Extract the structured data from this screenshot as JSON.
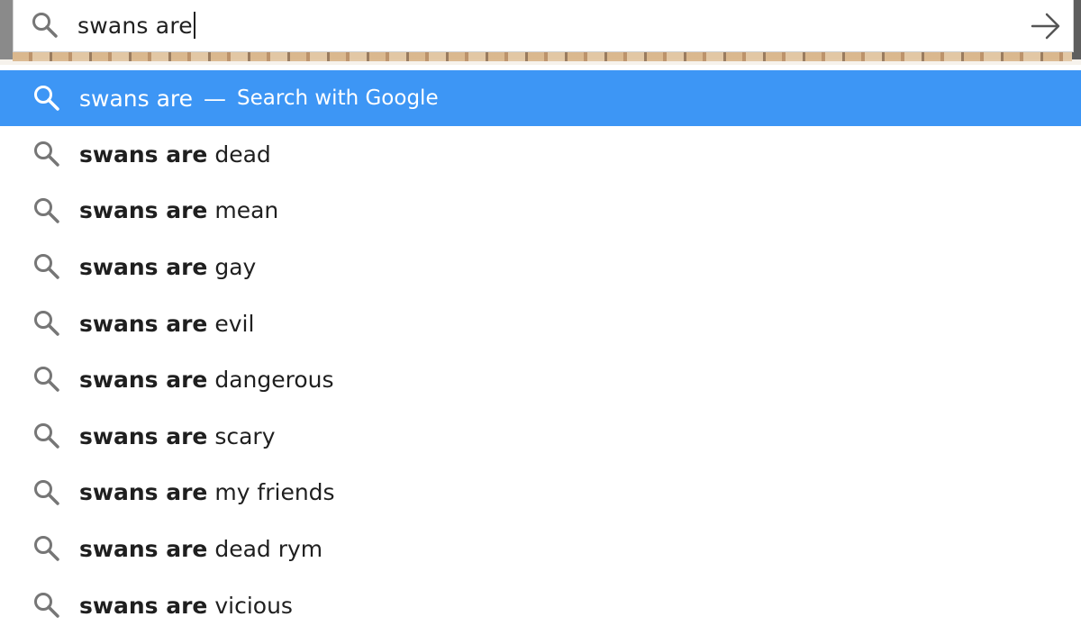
{
  "search": {
    "query": "swans are"
  },
  "dropdown": {
    "primary": {
      "query": "swans are",
      "separator": "—",
      "action": "Search with Google"
    },
    "suggestions": [
      {
        "prefix": "swans are",
        "rest": " dead"
      },
      {
        "prefix": "swans are",
        "rest": " mean"
      },
      {
        "prefix": "swans are",
        "rest": " gay"
      },
      {
        "prefix": "swans are",
        "rest": " evil"
      },
      {
        "prefix": "swans are",
        "rest": " dangerous"
      },
      {
        "prefix": "swans are",
        "rest": " scary"
      },
      {
        "prefix": "swans are",
        "rest": " my friends"
      },
      {
        "prefix": "swans are",
        "rest": " dead rym"
      },
      {
        "prefix": "swans are",
        "rest": " vicious"
      }
    ]
  },
  "icons": {
    "search": "search-icon",
    "go": "arrow-right-icon"
  },
  "colors": {
    "selected_row": "#3d96f5",
    "text": "#1f1f1f",
    "icon_gray": "#767676"
  }
}
